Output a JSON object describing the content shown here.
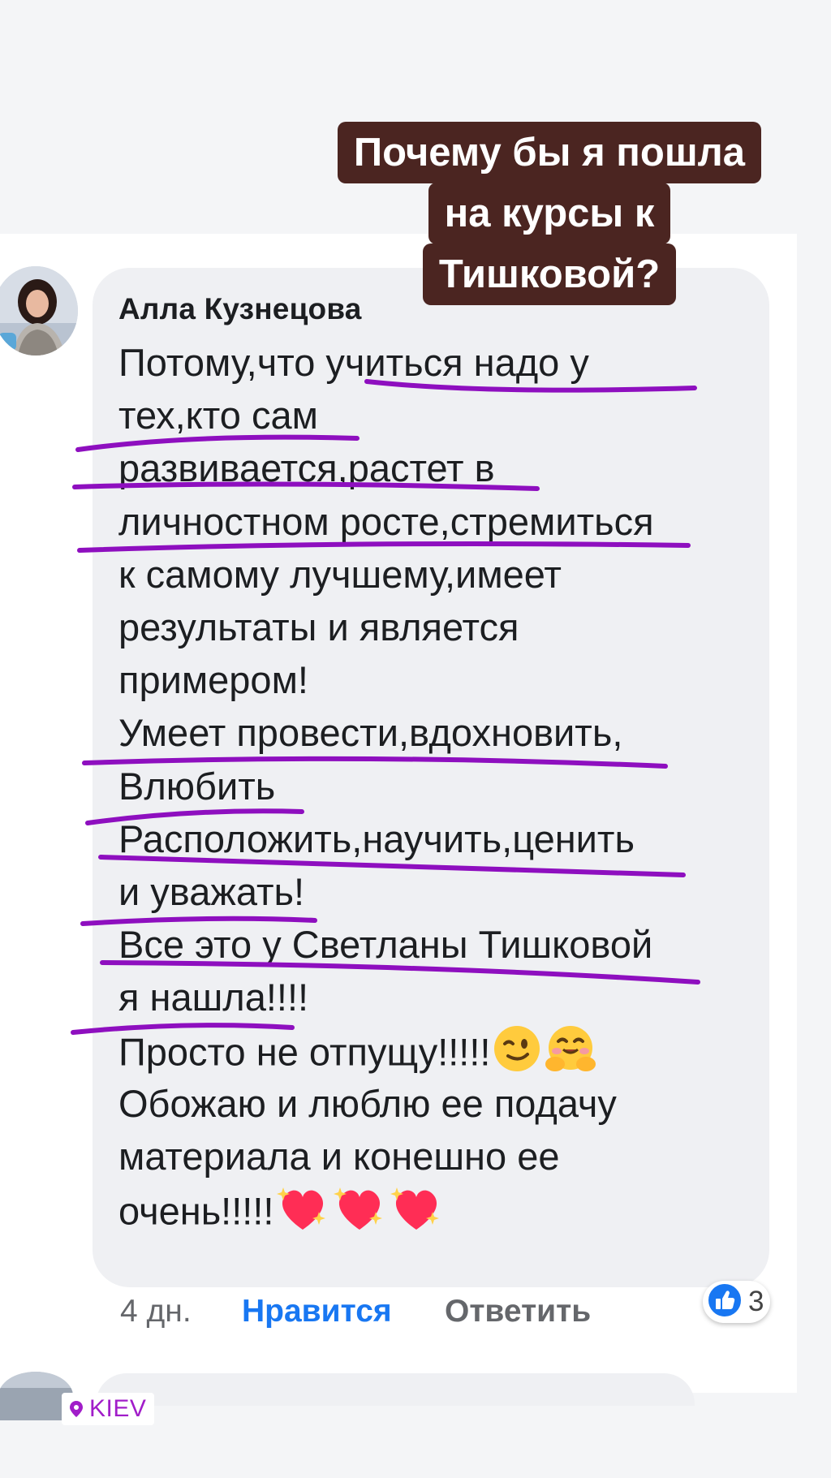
{
  "story_title": {
    "lines": [
      "Почему бы я пошла",
      "на курсы к",
      "Тишковой?"
    ]
  },
  "comment": {
    "author": "Алла Кузнецова",
    "lines": [
      "Потому,что  учиться   надо у",
      "тех,кто сам",
      "развивается,растет в",
      "личностном росте,стремиться",
      "к самому лучшему,имеет",
      "результаты и является",
      "примером!",
      "Умеет провести,вдохновить,",
      "Влюбить",
      "Расположить,научить,ценить",
      "и уважать!",
      "Все это у Светланы Тишковой",
      "я нашла!!!!",
      "Просто не отпущу!!!!!",
      "Обожаю и люблю ее подачу",
      "материала и конешно ее",
      "очень!!!!!"
    ],
    "emojis": {
      "line14": [
        "winking-face-emoji",
        "hugging-face-emoji"
      ],
      "line17": [
        "sparkling-heart-emoji",
        "sparkling-heart-emoji",
        "sparkling-heart-emoji"
      ]
    },
    "time": "4 дн.",
    "like_label": "Нравится",
    "reply_label": "Ответить",
    "reaction_icon": "thumbs-up-icon",
    "reaction_count": "3"
  },
  "location_sticker": {
    "icon": "location-pin-icon",
    "label": "KIEV"
  },
  "colors": {
    "title_bg": "#4b2521",
    "underline": "#8e0fbf",
    "like_blue": "#1877f2",
    "bubble_bg": "#eff0f3"
  }
}
